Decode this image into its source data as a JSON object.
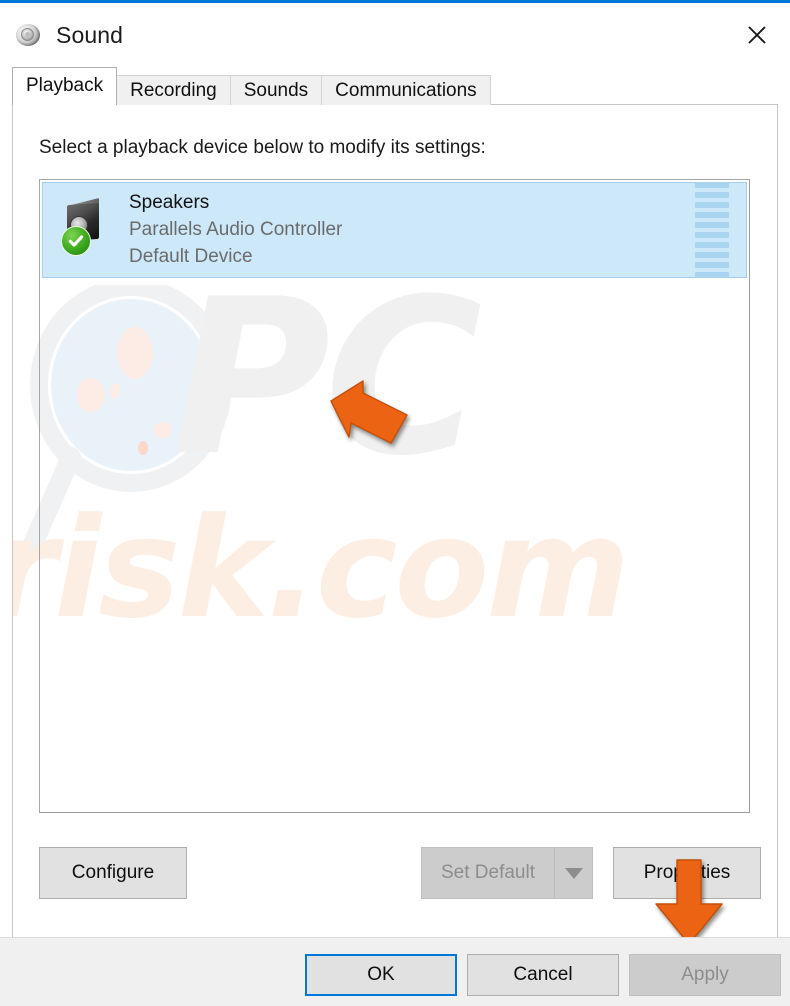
{
  "window": {
    "title": "Sound",
    "title_icon": "speaker-icon",
    "close_label": "✕",
    "accent_color": "#0078d7",
    "chrome_color": "#f0f0f0"
  },
  "tabs": [
    {
      "label": "Playback",
      "active": true
    },
    {
      "label": "Recording",
      "active": false
    },
    {
      "label": "Sounds",
      "active": false
    },
    {
      "label": "Communications",
      "active": false
    }
  ],
  "main": {
    "instruction": "Select a playback device below to modify its settings:",
    "devices": [
      {
        "name": "Speakers",
        "description": "Parallels Audio Controller",
        "status": "Default Device",
        "selected": true,
        "badge_icon": "green-check-icon",
        "device_icon": "speaker-device-icon",
        "meter_bars": 10,
        "meter_level": 0,
        "meter_color": "#a9d4ef",
        "selection_color": "#cde8f9"
      }
    ]
  },
  "mid_buttons": {
    "configure": {
      "label": "Configure",
      "enabled": true
    },
    "set_default": {
      "label": "Set Default",
      "enabled": false,
      "has_dropdown": true,
      "dropdown_icon": "chevron-down-icon"
    },
    "properties": {
      "label": "Properties",
      "enabled": true
    }
  },
  "footer": {
    "ok": {
      "label": "OK",
      "enabled": true,
      "focused": true
    },
    "cancel": {
      "label": "Cancel",
      "enabled": true,
      "focused": false
    },
    "apply": {
      "label": "Apply",
      "enabled": false,
      "focused": false
    }
  },
  "annotations": [
    {
      "icon": "orange-arrow-up-left-icon",
      "points_to": "Speakers device row",
      "color": "#ec6413"
    },
    {
      "icon": "orange-arrow-down-icon",
      "points_to": "Properties button",
      "color": "#ec6413"
    }
  ],
  "watermark": {
    "primary": "PC",
    "secondary": "risk.com",
    "logo_icon": "magnifier-icon"
  }
}
